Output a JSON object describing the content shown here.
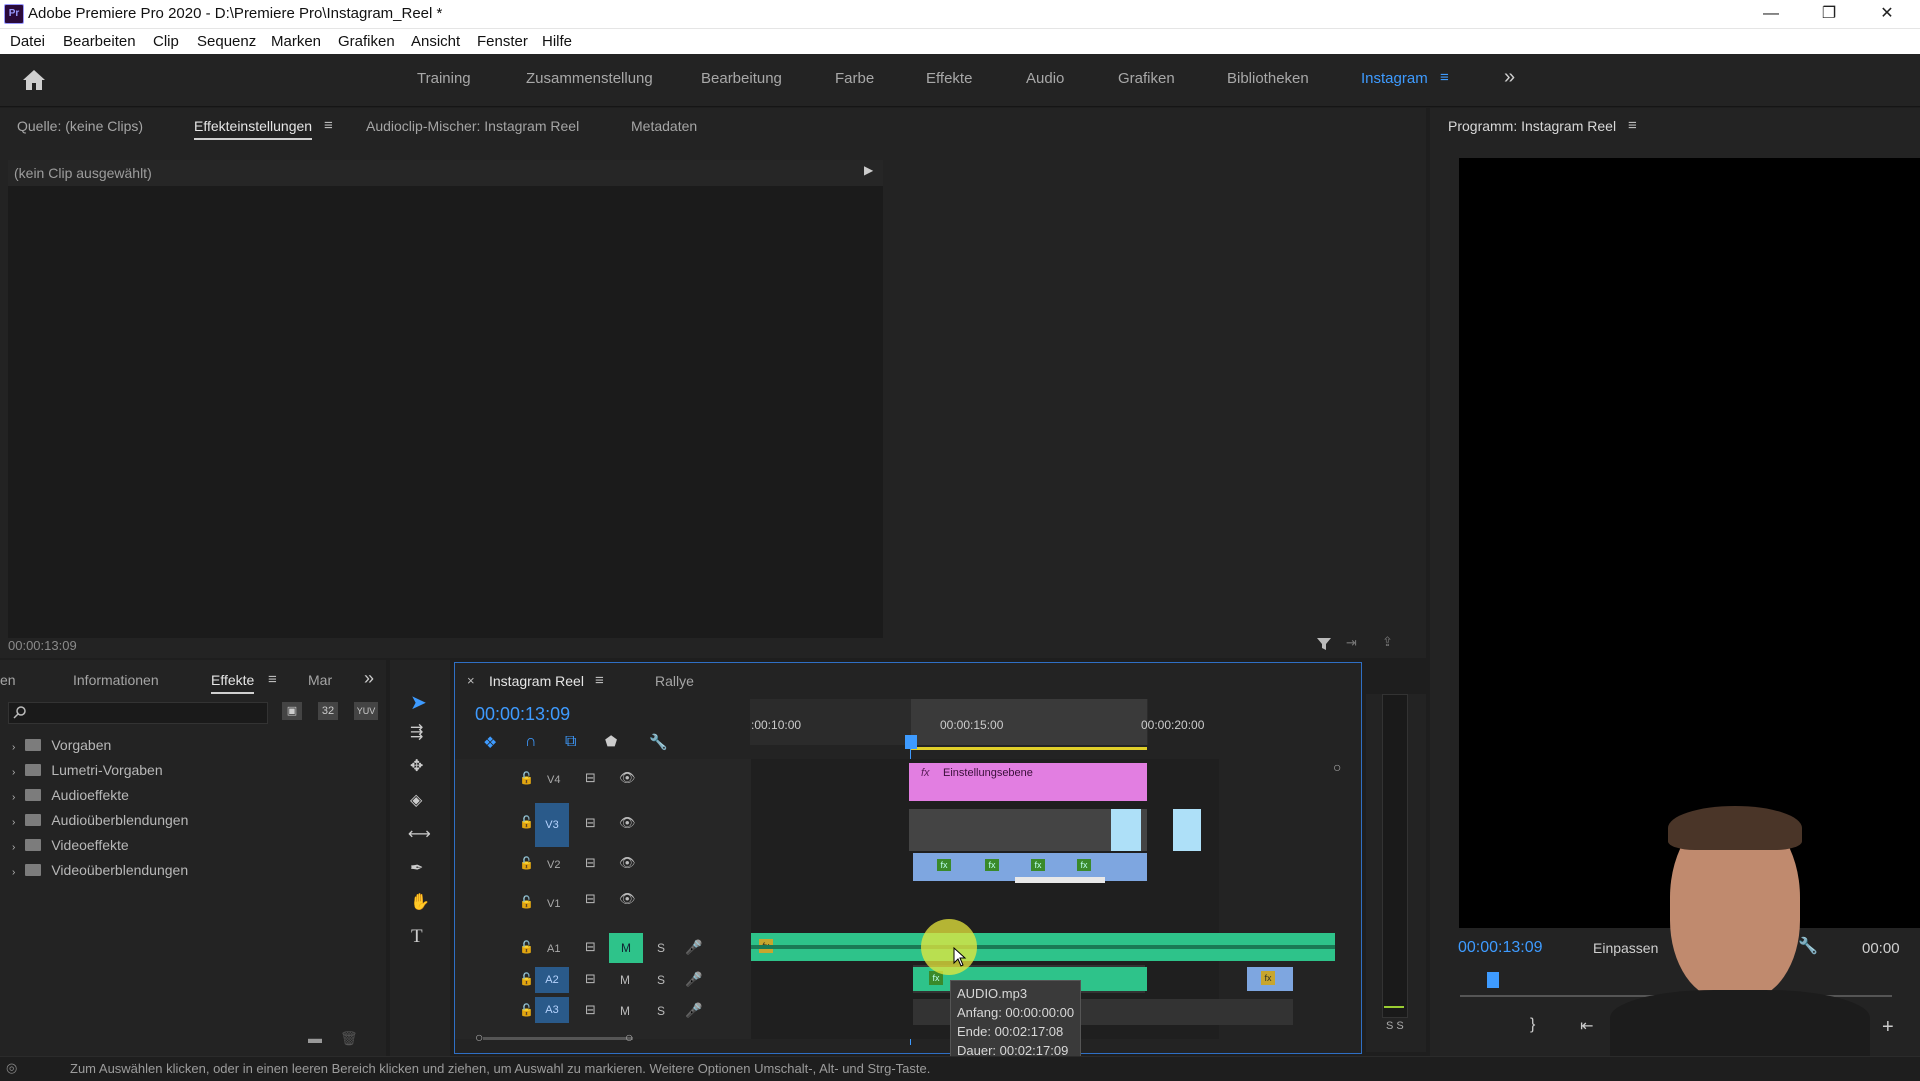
{
  "app": {
    "title": "Adobe Premiere Pro 2020 - D:\\Premiere Pro\\Instagram_Reel *",
    "logo_text": "Pr"
  },
  "window_controls": {
    "minimize": "—",
    "restore": "❐",
    "close": "✕"
  },
  "menu": [
    "Datei",
    "Bearbeiten",
    "Clip",
    "Sequenz",
    "Marken",
    "Grafiken",
    "Ansicht",
    "Fenster",
    "Hilfe"
  ],
  "workspaces": {
    "tabs": [
      "Training",
      "Zusammenstellung",
      "Bearbeitung",
      "Farbe",
      "Effekte",
      "Audio",
      "Grafiken",
      "Bibliotheken",
      "Instagram"
    ],
    "active": "Instagram",
    "more": "»"
  },
  "source_panel": {
    "tabs": [
      "Quelle: (keine Clips)",
      "Effekteinstellungen",
      "Audioclip-Mischer: Instagram Reel",
      "Metadaten"
    ],
    "active": "Effekteinstellungen",
    "no_clip": "(kein Clip ausgewählt)",
    "timecode": "00:00:13:09"
  },
  "program_panel": {
    "title": "Programm: Instagram Reel",
    "timecode": "00:00:13:09",
    "fit": "Einpassen",
    "right_timecode": "00:00"
  },
  "effects_panel": {
    "tabs": [
      "en",
      "Informationen",
      "Effekte",
      "Mar"
    ],
    "active": "Effekte",
    "more": "»",
    "icons": [
      "new-bin-icon",
      "32-icon",
      "yuv-icon"
    ],
    "icon_labels": [
      "32",
      "YUV"
    ],
    "items": [
      "Vorgaben",
      "Lumetri-Vorgaben",
      "Audioeffekte",
      "Audioüberblendungen",
      "Videoeffekte",
      "Videoüberblendungen"
    ]
  },
  "timeline": {
    "tabs": [
      "Instagram Reel",
      "Rallye"
    ],
    "active": "Instagram Reel",
    "close_mark": "×",
    "timecode": "00:00:13:09",
    "ruler": [
      "00:00:10:00",
      "00:00:15:00",
      "00:00:20:00"
    ],
    "ruler_first": ":00:10:00",
    "video_tracks": [
      "V4",
      "V3",
      "V2",
      "V1"
    ],
    "audio_tracks": [
      "A1",
      "A2",
      "A3"
    ],
    "mute": "M",
    "solo": "S",
    "adjustment_layer": "Einstellungsebene",
    "fx": "fx"
  },
  "tooltip": {
    "name": "AUDIO.mp3",
    "start": "Anfang: 00:00:00:00",
    "end": "Ende: 00:02:17:08",
    "duration": "Dauer: 00:02:17:09"
  },
  "meter_label": "S S",
  "status_bar": "Zum Auswählen klicken, oder in einen leeren Bereich klicken und ziehen, um Auswahl zu markieren. Weitere Optionen Umschalt-, Alt- und Strg-Taste.",
  "colors": {
    "accent": "#3e9bff",
    "adjustment_clip": "#e27ee1",
    "video_clip": "#7ea6e0",
    "audio_clip": "#2ec38a",
    "timecode": "#3e9bff"
  }
}
